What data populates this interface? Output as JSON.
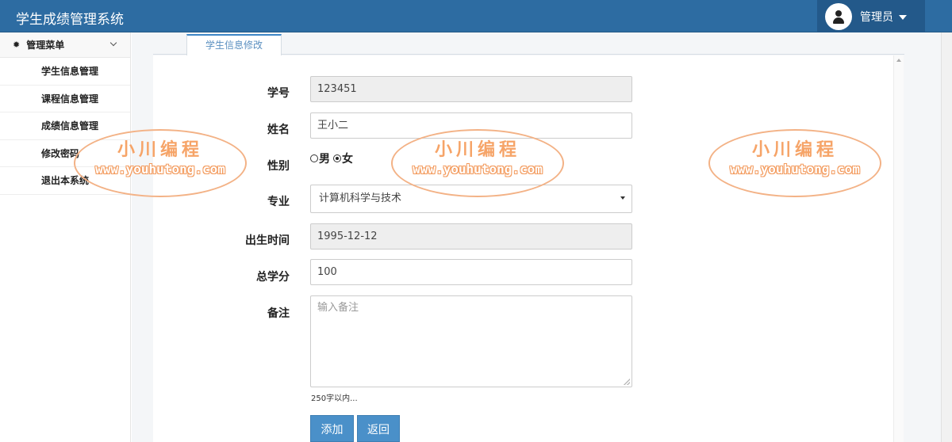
{
  "header": {
    "app_title": "学生成绩管理系统",
    "user_name": "管理员"
  },
  "sidebar": {
    "menu_title": "管理菜单",
    "items": [
      {
        "label": "学生信息管理"
      },
      {
        "label": "课程信息管理"
      },
      {
        "label": "成绩信息管理"
      },
      {
        "label": "修改密码"
      },
      {
        "label": "退出本系统"
      }
    ]
  },
  "tabs": [
    {
      "label": "学生信息修改"
    }
  ],
  "form": {
    "student_id": {
      "label": "学号",
      "value": "123451"
    },
    "name": {
      "label": "姓名",
      "value": "王小二"
    },
    "gender": {
      "label": "性别",
      "options": [
        "男",
        "女"
      ],
      "selected": "女"
    },
    "major": {
      "label": "专业",
      "value": "计算机科学与技术"
    },
    "birth_date": {
      "label": "出生时间",
      "value": "1995-12-12"
    },
    "total_credits": {
      "label": "总学分",
      "value": "100"
    },
    "remark": {
      "label": "备注",
      "placeholder": "输入备注",
      "hint": "250字以内..."
    },
    "submit_label": "添加",
    "back_label": "返回"
  },
  "watermark": {
    "cn": "小川编程",
    "en": "www.youhutong.com"
  }
}
